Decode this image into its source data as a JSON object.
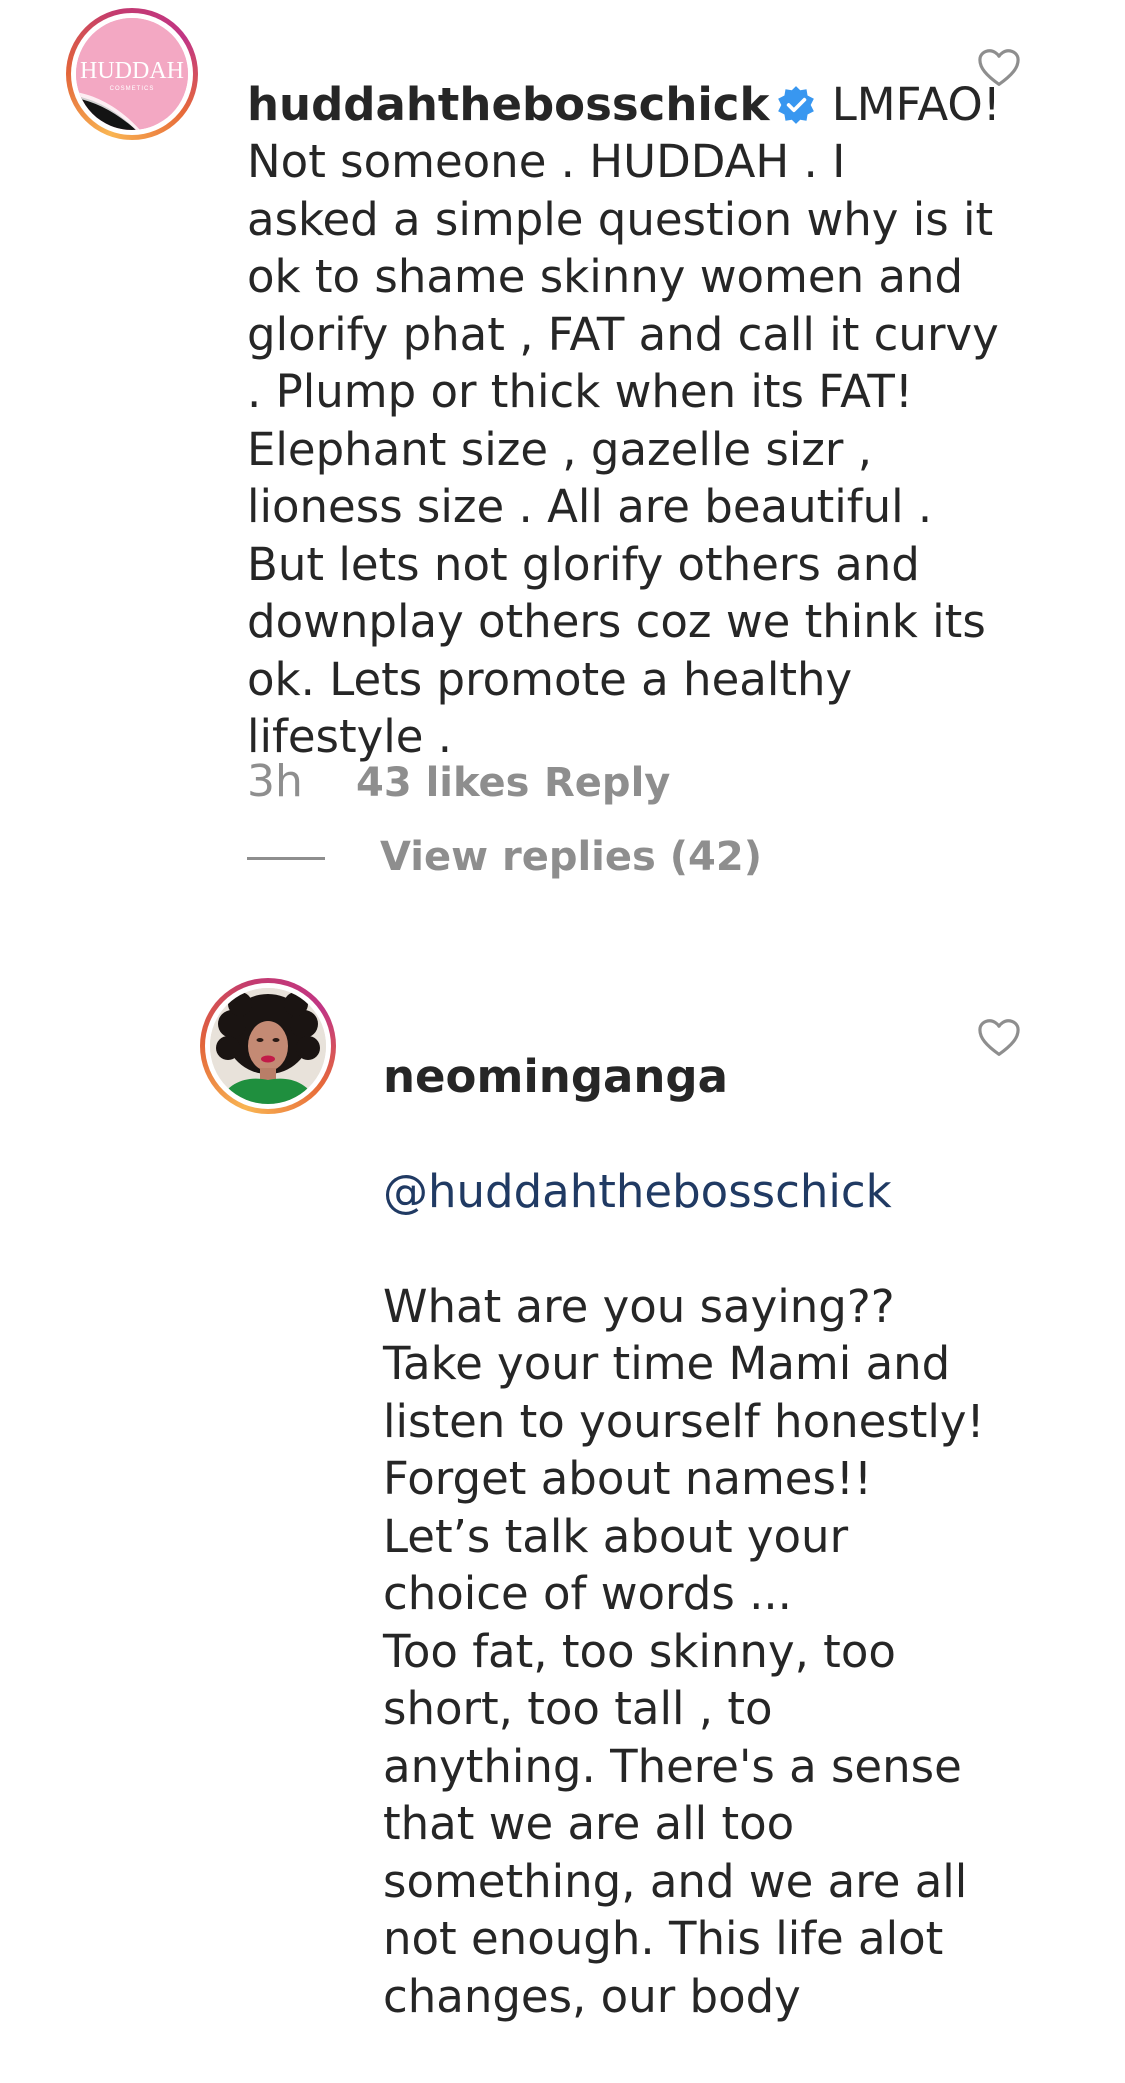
{
  "comments": [
    {
      "username": "huddahthebosschick",
      "verified": true,
      "avatar_text": "HUDDAH",
      "avatar_subtext": "COSMETICS",
      "text": " LMFAO!\nNot someone . HUDDAH . I\nasked a simple question why is it\nok to shame skinny women and\nglorify phat , FAT and call it curvy\n. Plump or thick when its FAT!\nElephant size , gazelle sizr ,\nlioness size . All are beautiful .\nBut lets not glorify others and\ndownplay others coz we think its\nok. Lets promote a healthy\nlifestyle .",
      "time": "3h",
      "likes": "43 likes",
      "reply_label": "Reply",
      "view_replies": "View replies (42)"
    },
    {
      "username": "neominganga",
      "verified": false,
      "mention": "@huddahthebosschick",
      "text": "What are you saying??\nTake your time Mami and\nlisten to yourself honestly!\nForget about names!!\nLet’s talk about your\nchoice of words ...\nToo fat, too skinny, too\nshort, too tall , to\nanything. There's a sense\nthat we are all too\nsomething, and we are all\nnot enough. This life alot\nchanges, our body"
    }
  ],
  "icons": {
    "like": "heart-outline-icon",
    "verified": "verified-badge-icon"
  },
  "colors": {
    "text": "#262626",
    "secondary": "#8e8e8e",
    "verified": "#3897f0",
    "mention": "#203a63",
    "avatar_pink": "#f2a9c4"
  }
}
